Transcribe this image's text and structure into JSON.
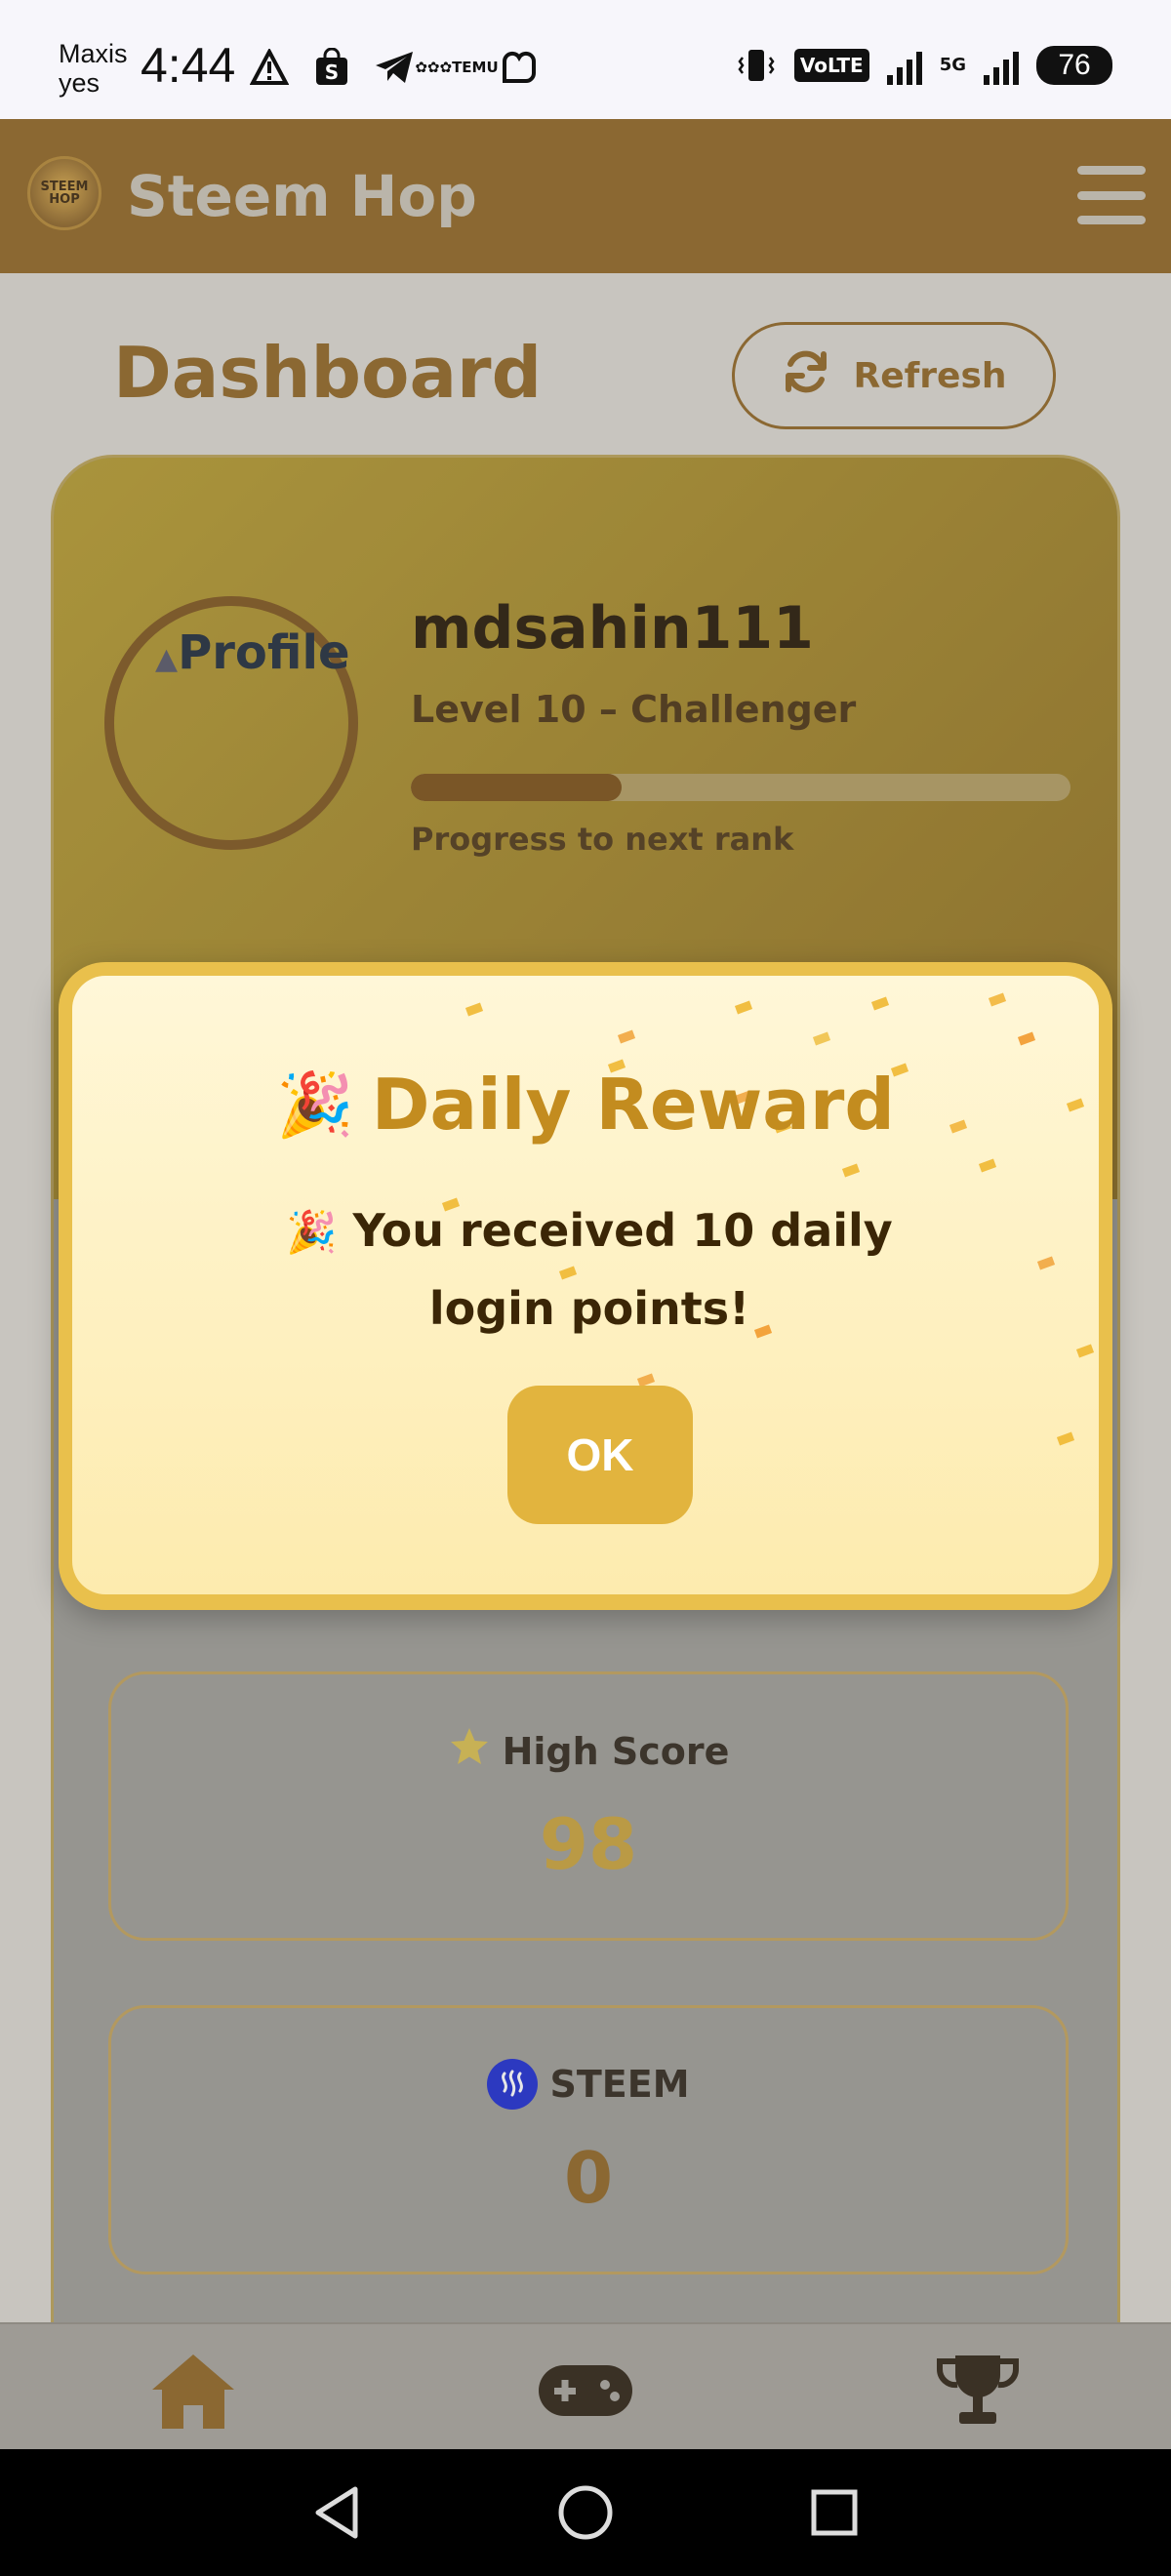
{
  "status_bar": {
    "carrier_line1": "Maxis",
    "carrier_line2": "yes",
    "time": "4:44",
    "temu_label": "TEMU",
    "volte": "VoLTE",
    "net_type": "5G",
    "battery": "76"
  },
  "app": {
    "title": "Steem Hop",
    "logo_text_1": "STEEM",
    "logo_text_2": "HOP"
  },
  "dashboard": {
    "title": "Dashboard",
    "refresh_label": "Refresh"
  },
  "profile": {
    "avatar_alt": "Profile",
    "username": "mdsahin111",
    "level": "Level 10 – Challenger",
    "progress_label": "Progress to next rank",
    "progress_fraction": 0.32
  },
  "stats": {
    "high_score_label": "High Score",
    "high_score_value": "98",
    "steem_label": "STEEM",
    "steem_value": "0"
  },
  "modal": {
    "title": "Daily Reward",
    "emoji": "🎉",
    "message": "You received 10 daily login points!",
    "ok_label": "OK"
  },
  "colors": {
    "brand": "#8f6523",
    "accent": "#e2b43e",
    "high_score_value": "#c9a23a",
    "steem_value": "#8f6523"
  },
  "icons": [
    "warning-icon",
    "shopping-icon",
    "telegram-icon",
    "temu-icon",
    "app-icon",
    "vibrate-icon",
    "menu-icon",
    "refresh-icon",
    "star-icon",
    "steem-icon",
    "home-icon",
    "gamepad-icon",
    "trophy-icon",
    "back-icon",
    "home-circle-icon",
    "recents-icon"
  ]
}
